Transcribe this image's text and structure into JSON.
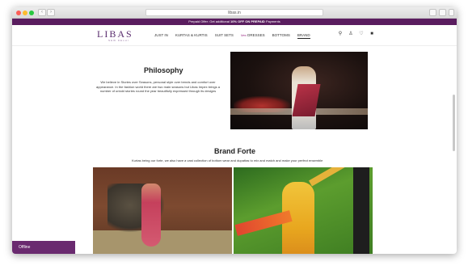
{
  "browser": {
    "url": "libas.in"
  },
  "promo_bar": {
    "text_prefix": "Prepaid Offer: Get additional ",
    "text_bold": "10% OFF ON PREPAID",
    "text_suffix": " Payments"
  },
  "header": {
    "logo": "LIBAS",
    "logo_sub": "NEW DELHI",
    "menu": [
      {
        "label": "JUST IN"
      },
      {
        "label": "KURTAS & KURTIS"
      },
      {
        "label": "SUIT SETS"
      },
      {
        "badge": "New",
        "label": "DRESSES"
      },
      {
        "label": "BOTTOMS"
      },
      {
        "label": "BRAND"
      }
    ],
    "icons": [
      "search-icon",
      "account-icon",
      "wishlist-icon",
      "cart-icon"
    ]
  },
  "philosophy": {
    "title": "Philosophy",
    "text": "We believe in Stories over Seasons, personal style over trends and comfort over appearance. In the fashion world there are two main seasons but Libas Impex brings a number of untold stories round the year beautifully expressed through its designs"
  },
  "brand_forte": {
    "title": "Brand Forte",
    "text": "Kurtas being our forte, we also have a vast collection of bottom wear and dupattas to mix and match and make your perfect ensemble"
  },
  "chat": {
    "status": "Offline"
  }
}
